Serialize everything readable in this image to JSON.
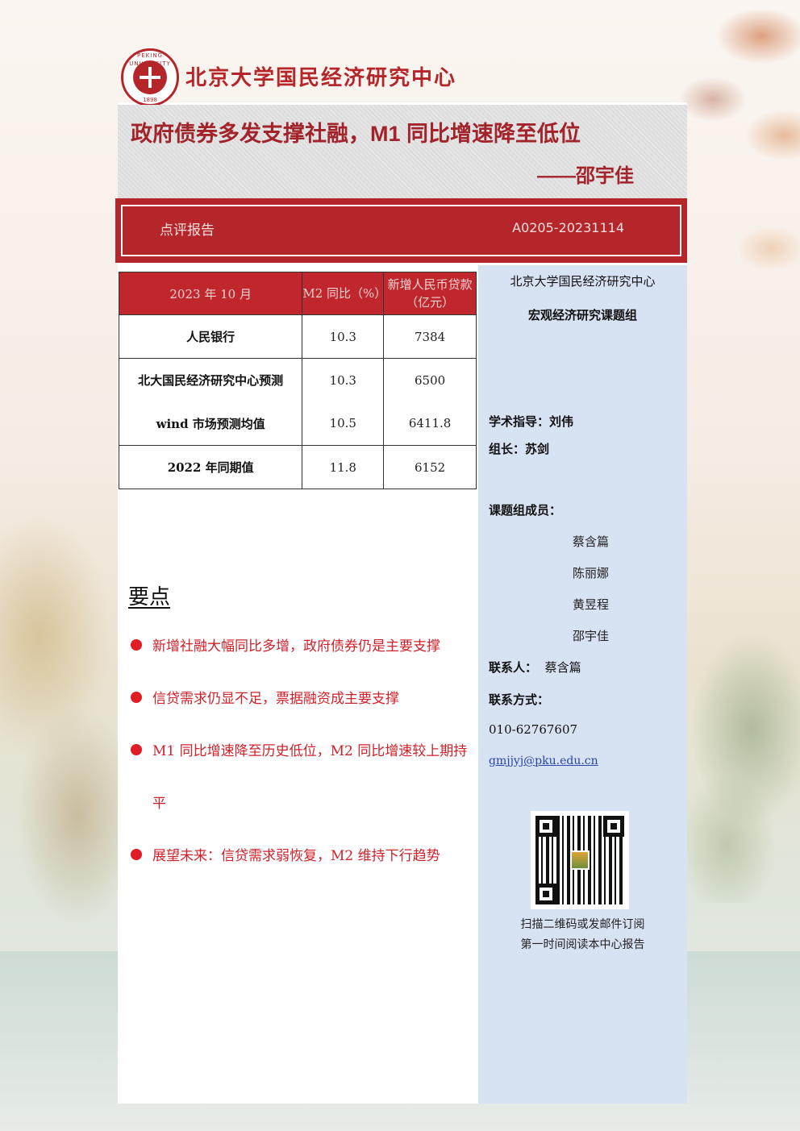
{
  "header": {
    "org_name": "北京大学国民经济研究中心",
    "seal_text": "PEKING UNIVERSITY",
    "seal_year": "1898"
  },
  "title": {
    "main": "政府债券多发支撑社融，M1 同比增速降至低位",
    "author": "——邵宇佳"
  },
  "report_band": {
    "type": "点评报告",
    "code": "A0205-20231114"
  },
  "table": {
    "header": [
      "2023 年 10 月",
      "M2 同比（%）",
      "新增人民币贷款（亿元）"
    ],
    "rows": [
      {
        "label": "人民银行",
        "m2": "10.3",
        "loans": "7384"
      },
      {
        "label": "北大国民经济研究中心预测",
        "m2": "10.3",
        "loans": "6500"
      },
      {
        "label": "wind 市场预测均值",
        "m2": "10.5",
        "loans": "6411.8"
      },
      {
        "label": "2022 年同期值",
        "m2": "11.8",
        "loans": "6152"
      }
    ]
  },
  "key_points": {
    "heading": "要点",
    "items": [
      "新增社融大幅同比多增，政府债券仍是主要支撑",
      "信贷需求仍显不足，票据融资成主要支撑",
      "M1 同比增速降至历史低位，M2 同比增速较上期持平",
      "展望未来：信贷需求弱恢复，M2 维持下行趋势"
    ]
  },
  "sidebar": {
    "org": "北京大学国民经济研究中心",
    "group": "宏观经济研究课题组",
    "advisor_label": "学术指导：",
    "advisor": "刘伟",
    "leader_label": "组长：",
    "leader": "苏剑",
    "members_label": "课题组成员：",
    "members": [
      "蔡含篇",
      "陈丽娜",
      "黄昱程",
      "邵宇佳"
    ],
    "contact_label": "联系人：",
    "contact": "蔡含篇",
    "contact_method_label": "联系方式：",
    "phone": "010-62767607",
    "email": "gmjjyj@pku.edu.cn",
    "qr_caption": [
      "扫描二维码或发邮件订阅",
      "第一时间阅读本中心报告"
    ]
  },
  "colors": {
    "brand_red": "#b5262a",
    "sidebar_blue": "#d7e2f2",
    "bullet_red": "#e01c25"
  }
}
